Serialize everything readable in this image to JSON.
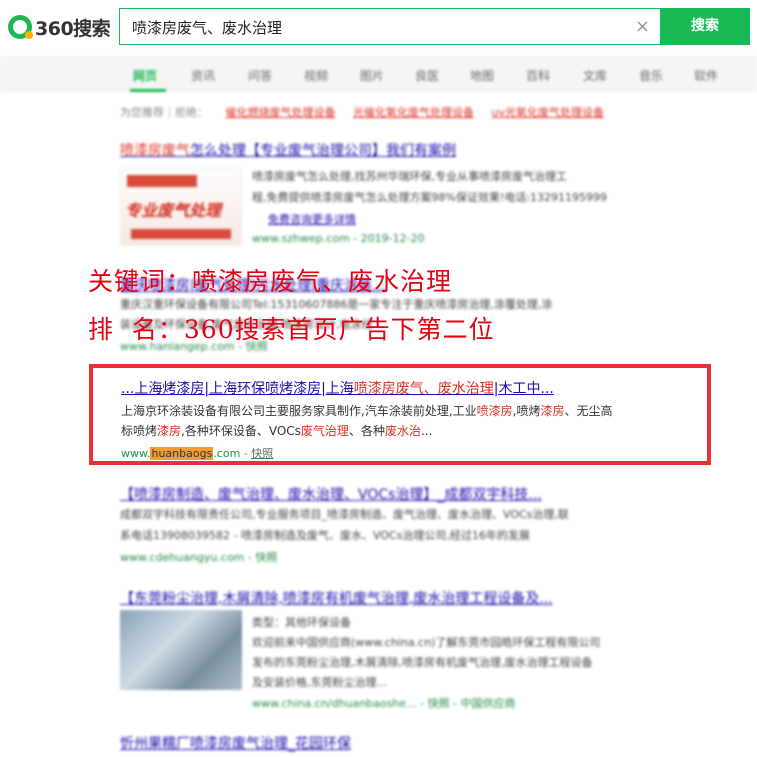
{
  "header": {
    "logo_text": "360搜索",
    "query": "喷漆房废气、废水治理",
    "clear_glyph": "×",
    "search_button": "搜索"
  },
  "nav": {
    "tabs": [
      "网页",
      "资讯",
      "问答",
      "视频",
      "图片",
      "良医",
      "地图",
      "百科",
      "文库",
      "音乐",
      "软件"
    ]
  },
  "overlay": {
    "line1": "关键词：喷漆房废气、废水治理",
    "line2": "排  名：360搜索首页广告下第二位"
  },
  "highlighted_result": {
    "title_prefix": "...上海烤漆房|上海环保喷烤漆房|上海",
    "title_red": "喷漆房废气、废水治理",
    "title_suffix": "|木工中...",
    "desc1_a": "上海京环涂装设备有限公司主要服务家具制作,汽车涂装前处理,工业",
    "desc1_b": "喷漆房",
    "desc1_c": ",喷烤",
    "desc1_d": "漆房",
    "desc1_e": "、无尘高",
    "desc2_a": "标喷烤",
    "desc2_b": "漆房",
    "desc2_c": ",各种环保设备、VOCs",
    "desc2_d": "废气治理",
    "desc2_e": "、各种",
    "desc2_f": "废水治",
    "desc2_g": "...",
    "url_prefix": "www.",
    "url_mark": "huanbaogs",
    "url_suffix": ".com",
    "url_sep": " - ",
    "snapshot": "快照"
  },
  "blurred": {
    "suggest_label": "为您推荐｜拒绝：",
    "suggest_items": [
      "催化燃烧废气处理设备",
      "光催化氧化废气处理设备",
      "uv光氧化废气处理设备"
    ],
    "r1_title_a": "喷漆房废气",
    "r1_title_b": "怎么处理【专业废气治理公司】我们有案例",
    "r1_line1": "喷漆房废气怎么处理,找苏州华瑞环保,专业从事喷漆房废气治理工",
    "r1_line2": "程,免费提供喷漆房废气怎么处理方案98%保证效果!电话:13291195999",
    "r1_line3": "免费咨询更多详情",
    "r1_url": "www.szhwep.com - 2019-12-20",
    "ad_img_text": "专业废气处理",
    "r2_title": "重庆喷漆房|废气处理|污水处理|重庆涂装...",
    "r2_line1": "重庆汉重环保设备有限公司Tel:15310607886是一家专注于重庆喷漆房治理,涂覆处理,涂",
    "r2_line2": "装设备及环保设备,废气废水治理,喷漆房设计,电泳线",
    "r2_url": "www.hanlangep.com - 快照",
    "r3_title": "【喷漆房制造、废气治理、废水治理、VOCs治理】_成都双宇科技...",
    "r3_line1": "成都双宇科技有限责任公司,专业服务项目_喷漆房制造、废气治理、废水治理、VOCs治理,联",
    "r3_line2": "系电话13908039582 - 喷漆房制造及废气、废水、VOCs治理公司,经过16年的发展",
    "r3_url": "www.cdehuangyu.com - 快照",
    "r4_title": "【东莞粉尘治理,木屑清除,喷漆房有机废气治理,废水治理工程设备及...",
    "r4_line1": "类型：其他环保设备",
    "r4_line2": "欢迎前来中国供应商(www.china.cn)了解东莞市园皓环保工程有限公司",
    "r4_line3": "发布的东莞粉尘治理,木屑清除,喷漆房有机废气治理,废水治理工程设备",
    "r4_line4": "及安装价格,东莞粉尘治理...",
    "r4_url": "www.china.cn/dhuanbaoshe... - 快照 - 中国供应商",
    "r5_title": "忻州果糯厂喷漆房废气治理_花园环保"
  }
}
